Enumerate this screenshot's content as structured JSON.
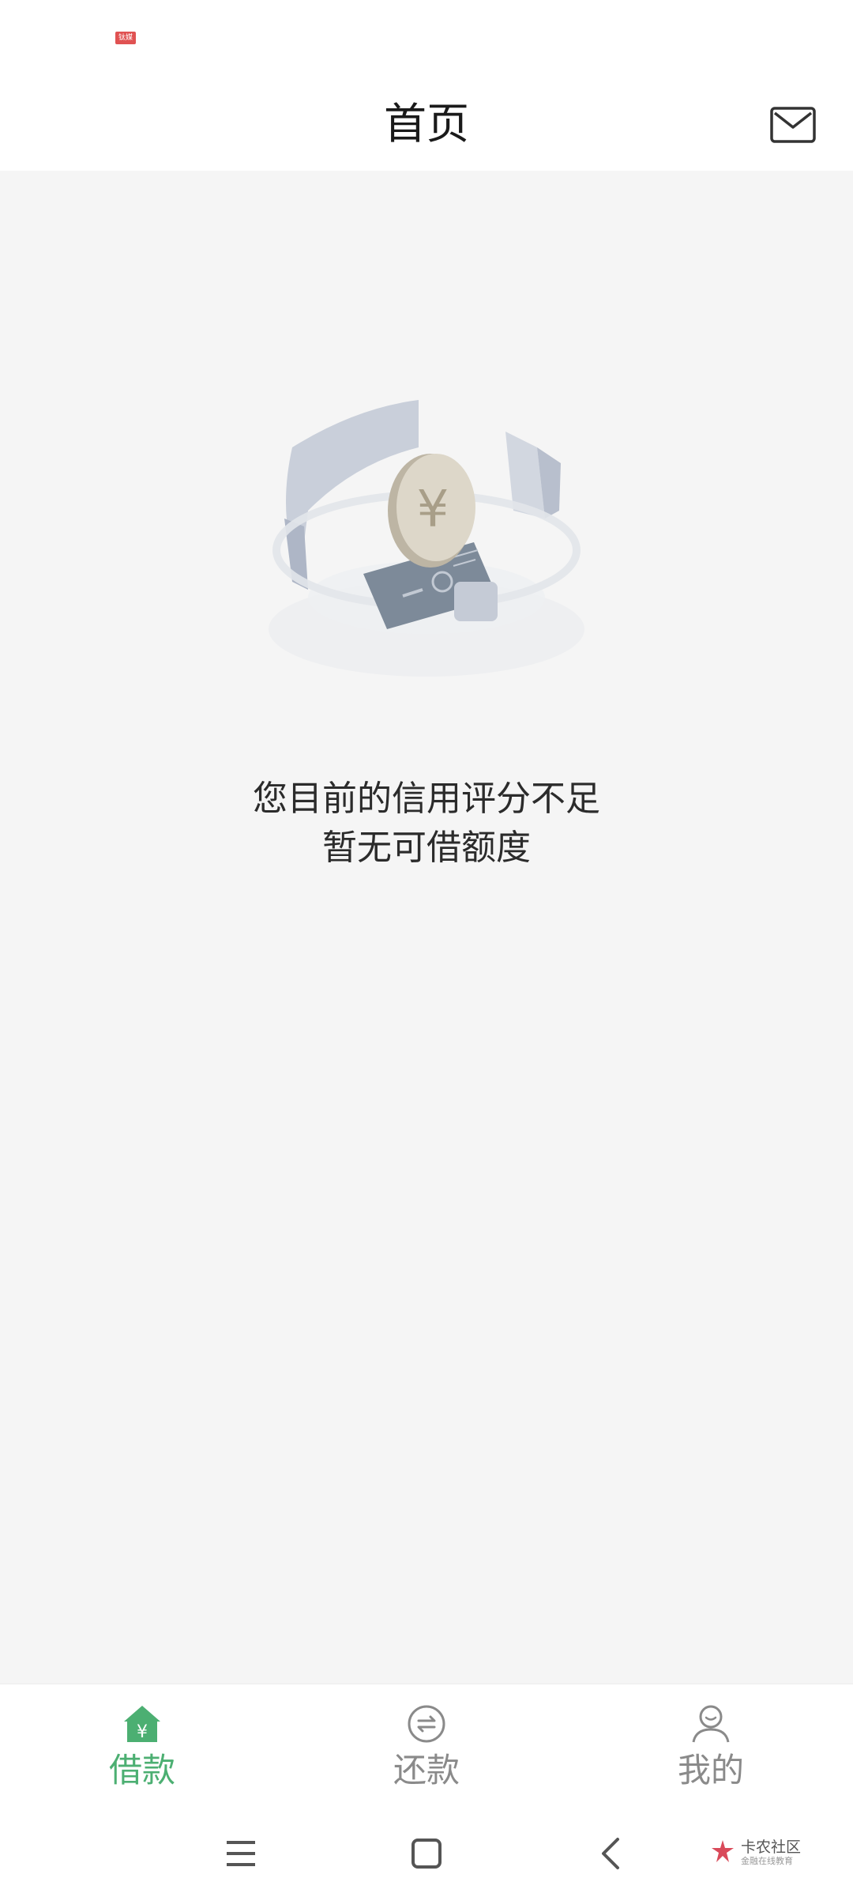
{
  "status_bar": {
    "badge_text": "钛媒"
  },
  "header": {
    "title": "首页",
    "mail_icon": "mail-icon"
  },
  "empty_state": {
    "illustration": "coin-card-illustration",
    "line1": "您目前的信用评分不足",
    "line2": "暂无可借额度"
  },
  "tabbar": {
    "active_color": "#4caf72",
    "inactive_color": "#8a8a8a",
    "tabs": [
      {
        "label": "借款",
        "icon": "home-yuan-icon",
        "active": true
      },
      {
        "label": "还款",
        "icon": "exchange-circle-icon",
        "active": false
      },
      {
        "label": "我的",
        "icon": "user-icon",
        "active": false
      }
    ]
  },
  "system_nav": {
    "buttons": [
      "menu-icon",
      "home-square-icon",
      "back-chevron-icon"
    ]
  },
  "watermark": {
    "title": "卡农社区",
    "subtitle": "金融在线教育"
  }
}
